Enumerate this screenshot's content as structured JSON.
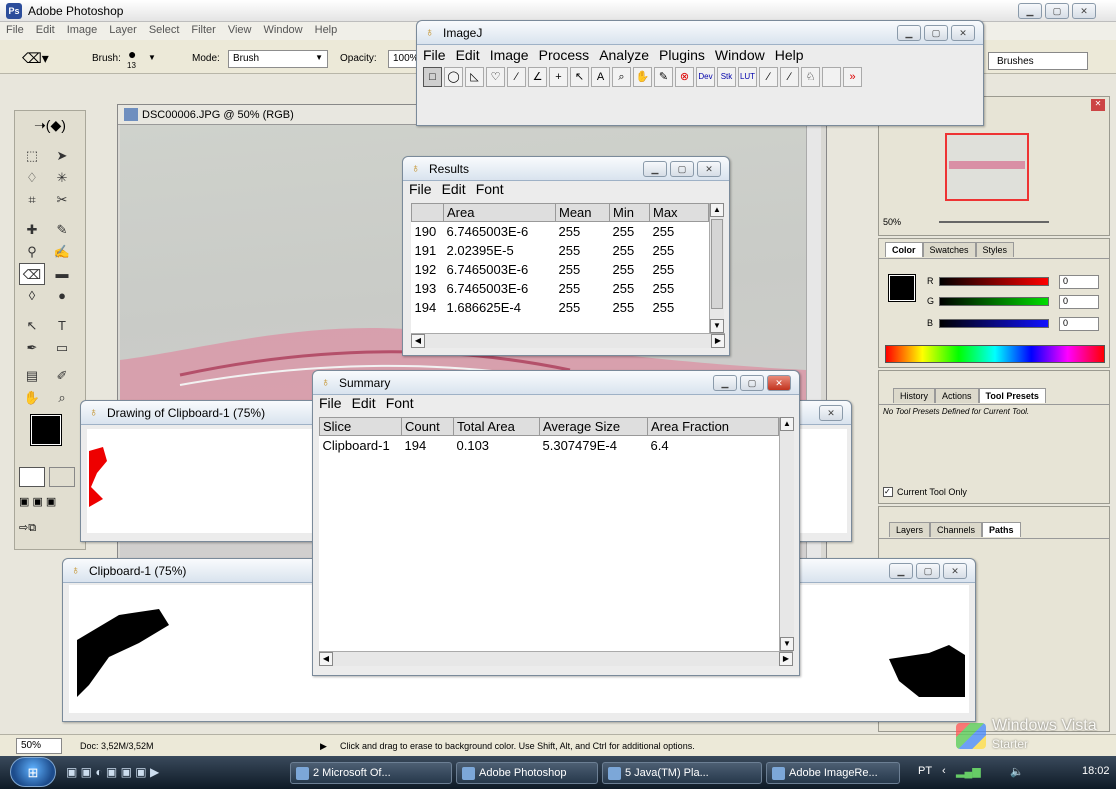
{
  "photoshop": {
    "title": "Adobe Photoshop",
    "menu": [
      "File",
      "Edit",
      "Image",
      "Layer",
      "Select",
      "Filter",
      "View",
      "Window",
      "Help"
    ],
    "options": {
      "brush_label": "Brush:",
      "brush_size": "13",
      "mode_label": "Mode:",
      "mode_value": "Brush",
      "opacity_label": "Opacity:",
      "opacity_value": "100%",
      "brushes_tab": "Brushes"
    },
    "document_title": "DSC00006.JPG @ 50% (RGB)",
    "navigator_zoom": "50%",
    "color_palette": {
      "tabs": [
        "Color",
        "Swatches",
        "Styles"
      ],
      "r_label": "R",
      "r_value": "0",
      "g_label": "G",
      "g_value": "0",
      "b_label": "B",
      "b_value": "0"
    },
    "tool_presets": {
      "tabs": [
        "History",
        "Actions",
        "Tool Presets"
      ],
      "message": "No Tool Presets Defined for Current Tool.",
      "current_tool_only": "Current Tool Only"
    },
    "layers_palette": {
      "tabs": [
        "Layers",
        "Channels",
        "Paths"
      ]
    },
    "status": {
      "zoom": "50%",
      "doc_size": "Doc: 3,52M/3,52M",
      "hint": "Click and drag to erase to background color.  Use Shift, Alt, and Ctrl for additional options."
    }
  },
  "imagej": {
    "title": "ImageJ",
    "menu": [
      "File",
      "Edit",
      "Image",
      "Process",
      "Analyze",
      "Plugins",
      "Window",
      "Help"
    ],
    "tools": [
      "□",
      "◯",
      "◺",
      "♡",
      "∕",
      "∠",
      "+",
      "↖",
      "A",
      "⌕",
      "✋",
      "✎",
      "⊗",
      "Dev",
      "Stk",
      "LUT",
      "∕",
      "∕",
      "♘",
      "",
      "»"
    ]
  },
  "results": {
    "title": "Results",
    "menu": [
      "File",
      "Edit",
      "Font"
    ],
    "headers": [
      "",
      "Area",
      "Mean",
      "Min",
      "Max"
    ],
    "rows": [
      [
        "190",
        "6.7465003E-6",
        "255",
        "255",
        "255"
      ],
      [
        "191",
        "2.02395E-5",
        "255",
        "255",
        "255"
      ],
      [
        "192",
        "6.7465003E-6",
        "255",
        "255",
        "255"
      ],
      [
        "193",
        "6.7465003E-6",
        "255",
        "255",
        "255"
      ],
      [
        "194",
        "1.686625E-4",
        "255",
        "255",
        "255"
      ]
    ]
  },
  "summary": {
    "title": "Summary",
    "menu": [
      "File",
      "Edit",
      "Font"
    ],
    "headers": [
      "Slice",
      "Count",
      "Total Area",
      "Average Size",
      "Area Fraction"
    ],
    "rows": [
      [
        "Clipboard-1",
        "194",
        "0.103",
        "5.307479E-4",
        "6.4"
      ]
    ]
  },
  "drawing_window": {
    "title": "Drawing of Clipboard-1 (75%)"
  },
  "clipboard_window": {
    "title": "Clipboard-1 (75%)"
  },
  "taskbar": {
    "items": [
      "2 Microsoft Of...",
      "Adobe Photoshop",
      "5 Java(TM) Pla...",
      "Adobe ImageRe..."
    ],
    "language": "PT",
    "clock": "18:02",
    "watermark": "Windows Vista",
    "watermark_sub": "Starter"
  }
}
